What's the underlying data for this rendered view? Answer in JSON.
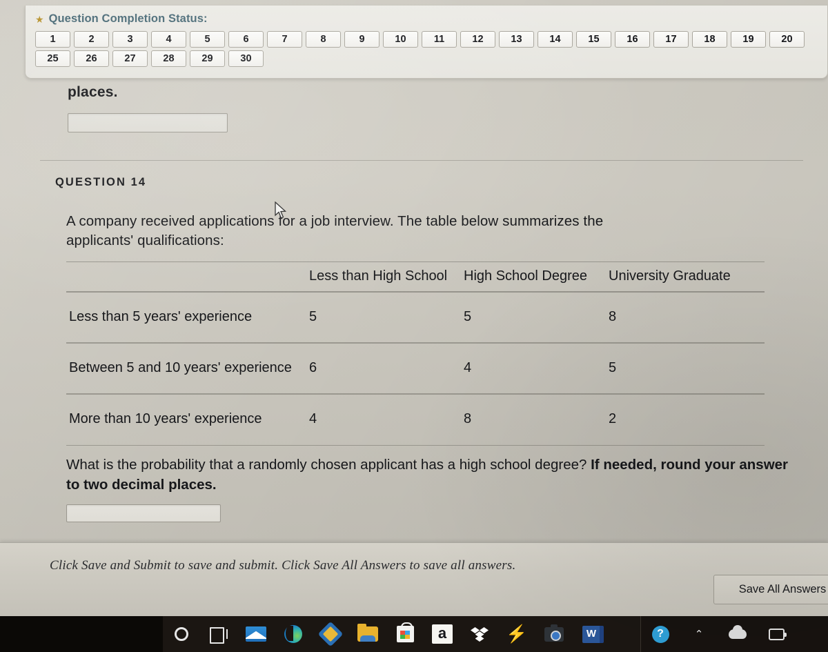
{
  "status_panel": {
    "icon": "star-icon",
    "title": "Question Completion Status:",
    "row1": [
      "1",
      "2",
      "3",
      "4",
      "5",
      "6",
      "7",
      "8",
      "9",
      "10",
      "11",
      "12",
      "13",
      "14",
      "15",
      "16",
      "17",
      "18",
      "19",
      "20"
    ],
    "row2": [
      "25",
      "26",
      "27",
      "28",
      "29",
      "30"
    ]
  },
  "previous_question": {
    "tail_text": "places.",
    "answer_value": "",
    "answer_placeholder": ""
  },
  "question": {
    "header": "QUESTION 14",
    "stem_line1": "A company received applications for a job interview. The table below summarizes the",
    "stem_line2": "applicants' qualifications:",
    "ask_plain": "What is the probability that a randomly chosen applicant has a high school degree? ",
    "ask_bold": "If needed, round your answer to two decimal places.",
    "answer_value": "",
    "answer_placeholder": ""
  },
  "table": {
    "corner": "",
    "columns": [
      "Less than High School",
      "High School Degree",
      "University Graduate"
    ],
    "rows": [
      {
        "label": "Less than 5 years' experience",
        "values": [
          "5",
          "5",
          "8"
        ]
      },
      {
        "label": "Between 5 and 10 years' experience",
        "values": [
          "6",
          "4",
          "5"
        ]
      },
      {
        "label": "More than 10 years' experience",
        "values": [
          "4",
          "8",
          "2"
        ]
      }
    ]
  },
  "bottom_bar": {
    "note": "Click Save and Submit to save and submit. Click Save All Answers to save all answers.",
    "save_all_label": "Save All Answers"
  },
  "taskbar": {
    "items": [
      {
        "name": "cortana-icon"
      },
      {
        "name": "task-view-icon"
      },
      {
        "name": "mail-icon"
      },
      {
        "name": "edge-browser-icon"
      },
      {
        "name": "security-shield-icon"
      },
      {
        "name": "file-explorer-icon"
      },
      {
        "name": "microsoft-store-icon"
      },
      {
        "name": "amazon-icon",
        "label": "a"
      },
      {
        "name": "dropbox-icon"
      },
      {
        "name": "lightning-app-icon",
        "label": "⚡"
      },
      {
        "name": "camera-icon"
      },
      {
        "name": "word-icon",
        "label": "W"
      }
    ],
    "tray": [
      {
        "name": "help-icon",
        "label": "?"
      },
      {
        "name": "show-hidden-icons-icon",
        "label": "⌃"
      },
      {
        "name": "cloud-icon"
      },
      {
        "name": "battery-icon"
      }
    ],
    "overflow_caret": "⌃"
  },
  "colors": {
    "panel_title": "#4c6c78",
    "star": "#b8942f",
    "text": "#16171a",
    "page_bg": "#c9c6bd"
  }
}
